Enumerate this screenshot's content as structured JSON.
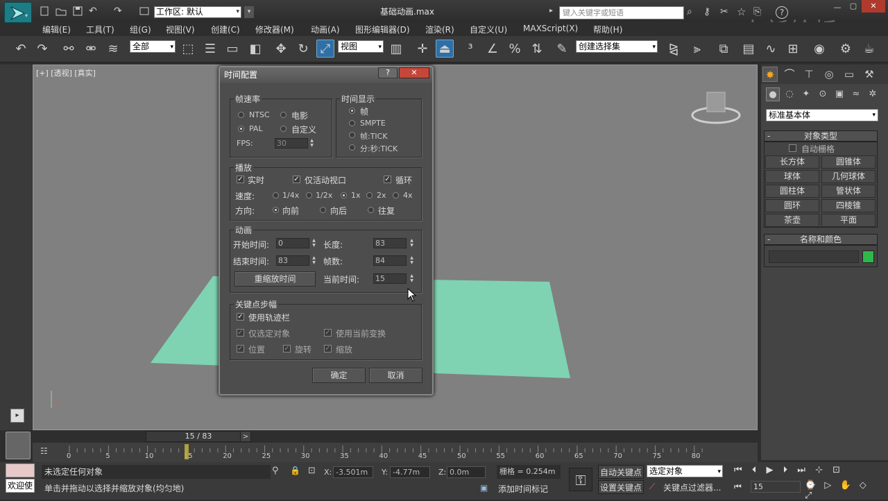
{
  "app": {
    "title": "基础动画.max",
    "workspace_label": "工作区: 默认",
    "search_placeholder": "键入关键字或短语",
    "watermark": "中新绘桥"
  },
  "menu": [
    "编辑(E)",
    "工具(T)",
    "组(G)",
    "视图(V)",
    "创建(C)",
    "修改器(M)",
    "动画(A)",
    "图形编辑器(D)",
    "渲染(R)",
    "自定义(U)",
    "MAXScript(X)",
    "帮助(H)"
  ],
  "toolbar": {
    "selection_filter": "全部",
    "ref_coord": "视图",
    "named_selection": "创建选择集"
  },
  "viewport": {
    "label": "[+] [透视] [真实]"
  },
  "dialog": {
    "title": "时间配置",
    "help": "?",
    "close": "✕",
    "frame_rate": {
      "label": "帧速率",
      "ntsc": "NTSC",
      "film": "电影",
      "pal": "PAL",
      "custom": "自定义",
      "fps_label": "FPS:",
      "fps_value": "30",
      "selected": "PAL"
    },
    "time_display": {
      "label": "时间显示",
      "frames": "帧",
      "smpte": "SMPTE",
      "frame_tick": "帧:TICK",
      "mm_ss_tick": "分:秒:TICK",
      "selected": "帧"
    },
    "playback": {
      "label": "播放",
      "realtime": "实时",
      "active_viewport": "仅活动视口",
      "loop": "循环",
      "speed_label": "速度:",
      "speeds": [
        "1/4x",
        "1/2x",
        "1x",
        "2x",
        "4x"
      ],
      "speed_selected": "1x",
      "direction_label": "方向:",
      "dir_forward": "向前",
      "dir_reverse": "向后",
      "dir_pingpong": "往复"
    },
    "animation": {
      "label": "动画",
      "start_label": "开始时间:",
      "start_value": "0",
      "end_label": "结束时间:",
      "end_value": "83",
      "length_label": "长度:",
      "length_value": "83",
      "frame_count_label": "帧数:",
      "frame_count_value": "84",
      "rescale_button": "重缩放时间",
      "current_label": "当前时间:",
      "current_value": "15"
    },
    "key_steps": {
      "label": "关键点步幅",
      "use_trackbar": "使用轨迹栏",
      "selected_only": "仅选定对象",
      "use_current_transform": "使用当前变换",
      "position": "位置",
      "rotation": "旋转",
      "scale": "缩放"
    },
    "ok": "确定",
    "cancel": "取消"
  },
  "command_panel": {
    "category": "标准基本体",
    "object_type_header": "对象类型",
    "autogrid": "自动栅格",
    "buttons": [
      "长方体",
      "圆锥体",
      "球体",
      "几何球体",
      "圆柱体",
      "管状体",
      "圆环",
      "四棱锥",
      "茶壶",
      "平面"
    ],
    "name_color_header": "名称和颜色",
    "color": "#2fb84a"
  },
  "timeline": {
    "slider_label": "15 / 83",
    "ticks": [
      "0",
      "5",
      "10",
      "15",
      "20",
      "25",
      "30",
      "35",
      "40",
      "45",
      "50",
      "55",
      "60",
      "65",
      "70",
      "75",
      "80"
    ],
    "current_frame": 15,
    "frame_end": 83
  },
  "status": {
    "welcome": "欢迎使",
    "selection": "未选定任何对象",
    "prompt": "单击并拖动以选择并缩放对象(均匀地)",
    "x_label": "X:",
    "x_value": "-3.501m",
    "y_label": "Y:",
    "y_value": "-4.77m",
    "z_label": "Z:",
    "z_value": "0.0m",
    "grid": "栅格 = 0.254m",
    "add_time_tag": "添加时间标记",
    "auto_key": "自动关键点",
    "set_key": "设置关键点",
    "key_mode": "选定对象",
    "key_filters": "关键点过滤器...",
    "frame_field": "15"
  }
}
